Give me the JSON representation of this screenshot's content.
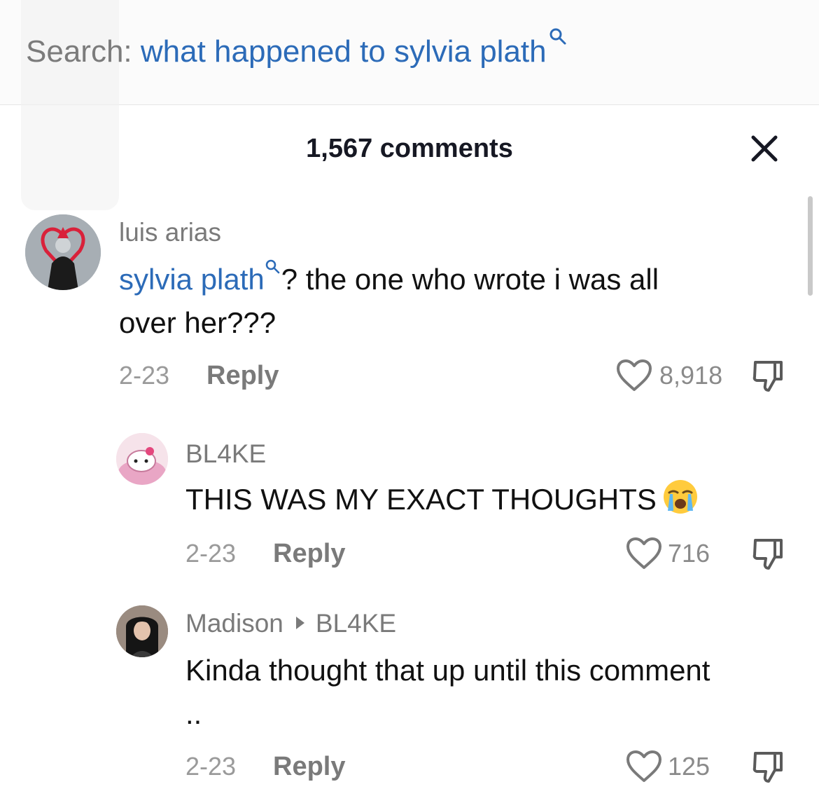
{
  "search": {
    "prefix": "Search:",
    "query": "what happened to sylvia plath",
    "search_icon": "search-icon"
  },
  "header": {
    "comments_count": "1,567 comments",
    "close_icon": "close-icon"
  },
  "comments": [
    {
      "username": "luis arias",
      "text_link": "sylvia plath",
      "text_line1_rest": "? the one who wrote i was all",
      "text_line2": "over her???",
      "date": "2-23",
      "reply": "Reply",
      "likes": "8,918"
    },
    {
      "username": "BL4KE",
      "text": "THIS WAS MY EXACT THOUGHTS",
      "emoji": "loudly-crying-face",
      "date": "2-23",
      "reply": "Reply",
      "likes": "716"
    },
    {
      "username": "Madison",
      "reply_to": "BL4KE",
      "text_line1": "Kinda thought that up until this comment",
      "text_line2": "..",
      "date": "2-23",
      "reply": "Reply",
      "likes": "125"
    }
  ],
  "colors": {
    "link": "#2c6bb8",
    "muted": "#7a7a7a",
    "text": "#111111"
  }
}
